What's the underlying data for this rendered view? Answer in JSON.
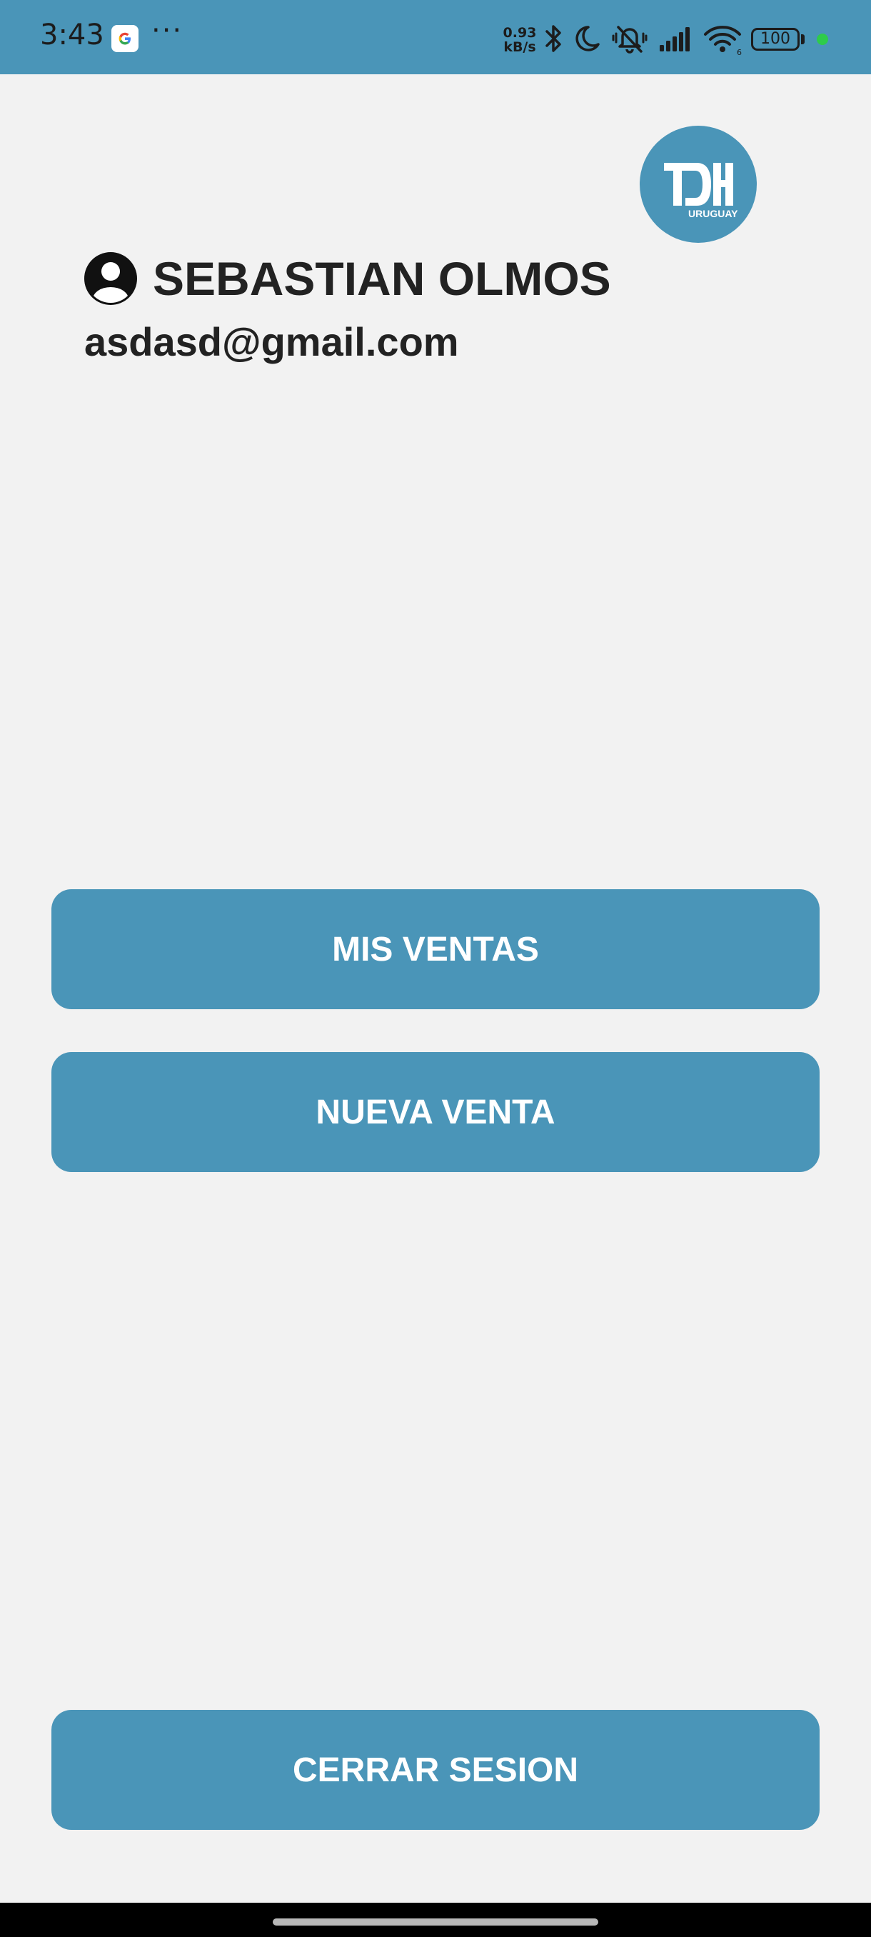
{
  "status_bar": {
    "time": "3:43",
    "more_indicator": "···",
    "net_speed_value": "0.93",
    "net_speed_unit": "kB/s",
    "battery_level": "100",
    "background_color": "#4a95b8",
    "icons": [
      "google-icon",
      "bluetooth-icon",
      "moon-icon",
      "bell-muted-icon",
      "signal-icon",
      "wifi-icon",
      "battery-icon"
    ]
  },
  "brand": {
    "logo_main": "TDH",
    "logo_sub": "URUGUAY"
  },
  "profile": {
    "name": "SEBASTIAN OLMOS",
    "email": "asdasd@gmail.com",
    "icon": "account-circle-icon"
  },
  "actions": {
    "mis_ventas_label": "MIS VENTAS",
    "nueva_venta_label": "NUEVA VENTA",
    "cerrar_sesion_label": "CERRAR SESION"
  },
  "colors": {
    "accent": "#4a95b8",
    "background": "#f2f2f2",
    "text": "#222222",
    "button_text": "#ffffff"
  }
}
